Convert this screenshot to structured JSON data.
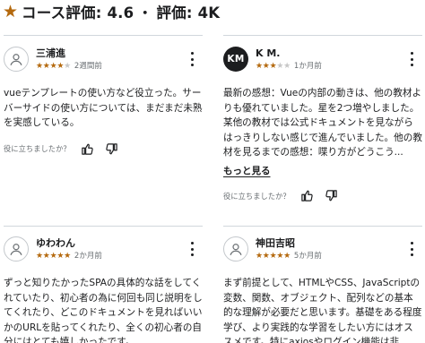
{
  "header": {
    "star_glyph": "★",
    "course_rating_label": "コース評価: 4.6",
    "separator": "•",
    "rating_count_label": "評価: 4K"
  },
  "star_glyph": "★",
  "colors": {
    "accent_star": "#b4690e",
    "empty_star": "#c7c7c7",
    "text": "#1c1d1f",
    "muted": "#6a6f73",
    "divider": "#d1d7dc"
  },
  "reviews": [
    {
      "name": "三浦進",
      "avatar": "person-icon",
      "rating": 4,
      "time": "2週間前",
      "text": "vueテンプレートの使い方など役立った。サーバーサイドの使い方については、まだまだ未熟を実感している。",
      "helpful_label": "役に立ちましたか？",
      "more_label": ""
    },
    {
      "name": "K M.",
      "avatar_initials": "KM",
      "rating": 3,
      "time": "1か月前",
      "text": "最新の感想：Vueの内部の動きは、他の教材よりも優れていました。星を2つ増やしました。某他の教材では公式ドキュメントを見ながらはっきりしない感じで進んでいました。他の教材を見るまでの感想：喋り方がどうこう...",
      "helpful_label": "役に立ちましたか？",
      "more_label": "もっと見る"
    },
    {
      "name": "ゆわわん",
      "avatar": "person-icon",
      "rating": 5,
      "time": "2か月前",
      "text": "ずっと知りたかったSPAの具体的な話をしてくれていたり、初心者の為に何回も同じ説明をしてくれたり、どこのドキュメントを見ればいいかのURLを貼ってくれたり、全くの初心者の自分にはとても嬉しかったです。",
      "helpful_label": "",
      "more_label": ""
    },
    {
      "name": "神田吉昭",
      "avatar": "person-icon",
      "rating": 5,
      "time": "5か月前",
      "text": "まず前提として、HTMLやCSS、JavaScriptの変数、関数、オブジェクト、配列などの基本的な理解が必要だと思います。基礎をある程度学び、より実践的な学習をしたい方にはオススメです。特にaxiosやログイン機能は非",
      "helpful_label": "",
      "more_label": ""
    }
  ]
}
